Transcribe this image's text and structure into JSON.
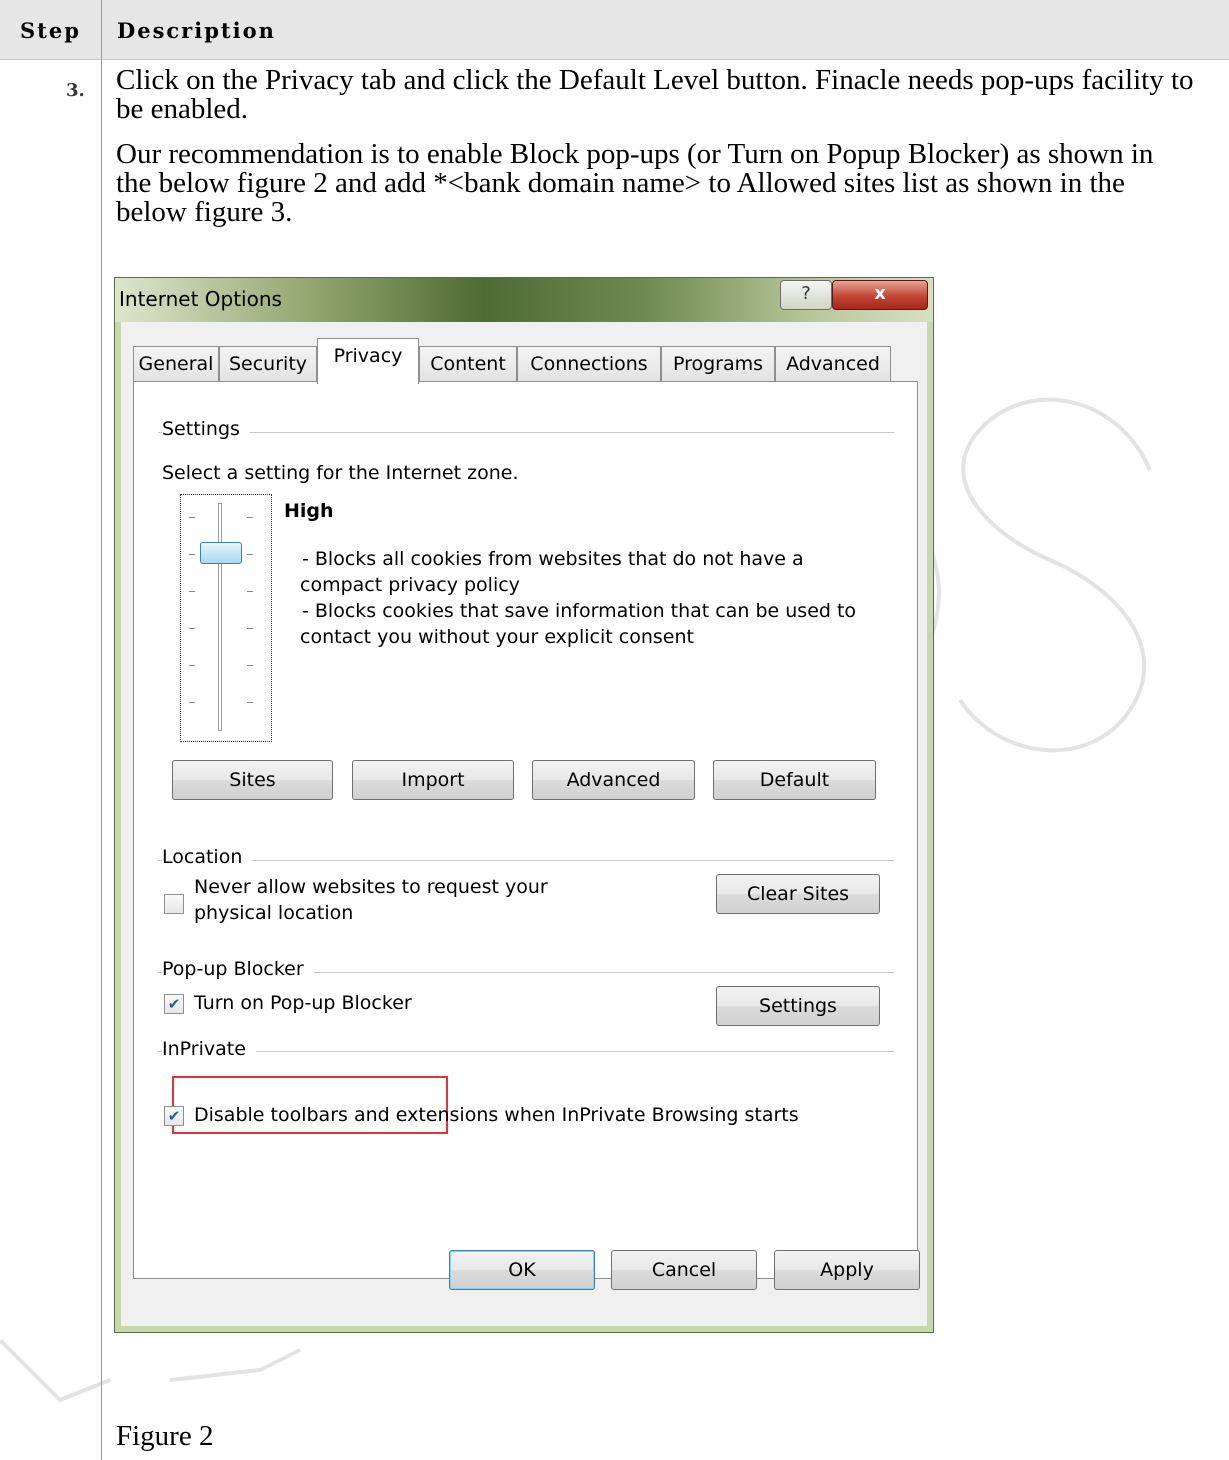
{
  "table": {
    "header_step": "Step",
    "header_description": "Description",
    "step_number": "3.",
    "paragraph_1": "Click on the Privacy tab and click the Default Level button. Finacle needs pop-ups facility to be enabled.",
    "paragraph_2": "Our recommendation is to enable Block pop-ups (or Turn on Popup Blocker) as shown in the below figure 2 and add *<bank domain name> to Allowed sites list as shown in the below figure 3.",
    "figure_caption": "Figure 2"
  },
  "dialog": {
    "title": "Internet Options",
    "help_label": "?",
    "close_label": "x",
    "tabs": [
      "General",
      "Security",
      "Privacy",
      "Content",
      "Connections",
      "Programs",
      "Advanced"
    ],
    "active_tab": "Privacy",
    "settings": {
      "group_label": "Settings",
      "prompt": "Select a setting for the Internet zone.",
      "level_name": "High",
      "level_desc_1": "- Blocks all cookies from websites that do not have a",
      "level_desc_2": "compact privacy policy",
      "level_desc_3": "- Blocks cookies that save information that can be used to",
      "level_desc_4": "contact you without your explicit consent",
      "buttons": {
        "sites": "Sites",
        "import": "Import",
        "advanced": "Advanced",
        "default": "Default"
      }
    },
    "location": {
      "group_label": "Location",
      "checkbox_label_1": "Never allow websites to request your",
      "checkbox_label_2": "physical location",
      "checked": false,
      "clear_sites": "Clear Sites"
    },
    "popup_blocker": {
      "group_label": "Pop-up Blocker",
      "checkbox_label": "Turn on Pop-up Blocker",
      "checked": true,
      "settings_button": "Settings"
    },
    "inprivate": {
      "group_label": "InPrivate",
      "checkbox_label": "Disable toolbars and extensions when InPrivate Browsing starts",
      "checked": true
    },
    "footer": {
      "ok": "OK",
      "cancel": "Cancel",
      "apply": "Apply"
    },
    "check_glyph": "✔"
  },
  "watermark_text": "FIBS"
}
